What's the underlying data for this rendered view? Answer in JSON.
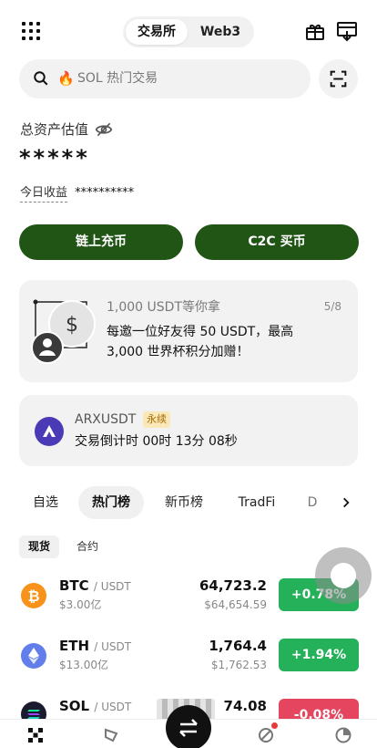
{
  "header": {
    "segments": [
      "交易所",
      "Web3"
    ]
  },
  "search": {
    "placeholder": "SOL 热门交易"
  },
  "assets": {
    "label": "总资产估值",
    "value": "*****",
    "pnl_label": "今日收益",
    "pnl_value": "**********"
  },
  "actions": {
    "onchain_deposit": "链上充币",
    "c2c_buy": "C2C 买币"
  },
  "promo": {
    "title": "1,000 USDT等你拿",
    "desc": "每邀一位好友得 50 USDT，最高 3,000 世界杯积分加赠！",
    "page": "5/8"
  },
  "countdown": {
    "symbol": "ARXUSDT",
    "badge": "永续",
    "text": "交易倒计时 00时 13分 08秒"
  },
  "tabs": [
    "自选",
    "热门榜",
    "新币榜",
    "TradFi",
    "D"
  ],
  "subtabs": [
    "现货",
    "合约"
  ],
  "market": [
    {
      "base": "BTC",
      "quote": "/ USDT",
      "volume": "$3.00亿",
      "price": "64,723.2",
      "fiat": "$64,654.59",
      "change": "+0.78%",
      "direction": "up",
      "color": "#f7931a"
    },
    {
      "base": "ETH",
      "quote": "/ USDT",
      "volume": "$13.00亿",
      "price": "1,764.4",
      "fiat": "$1,762.53",
      "change": "+1.94%",
      "direction": "up",
      "color": "#627eea"
    },
    {
      "base": "SOL",
      "quote": "/ USDT",
      "volume": "",
      "price": "74.08",
      "fiat": "",
      "change": "-0.08%",
      "direction": "down",
      "color": "#1b1b2f"
    }
  ],
  "colors": {
    "primary_green": "#215516",
    "up": "#24b15a",
    "down": "#e5455f"
  }
}
